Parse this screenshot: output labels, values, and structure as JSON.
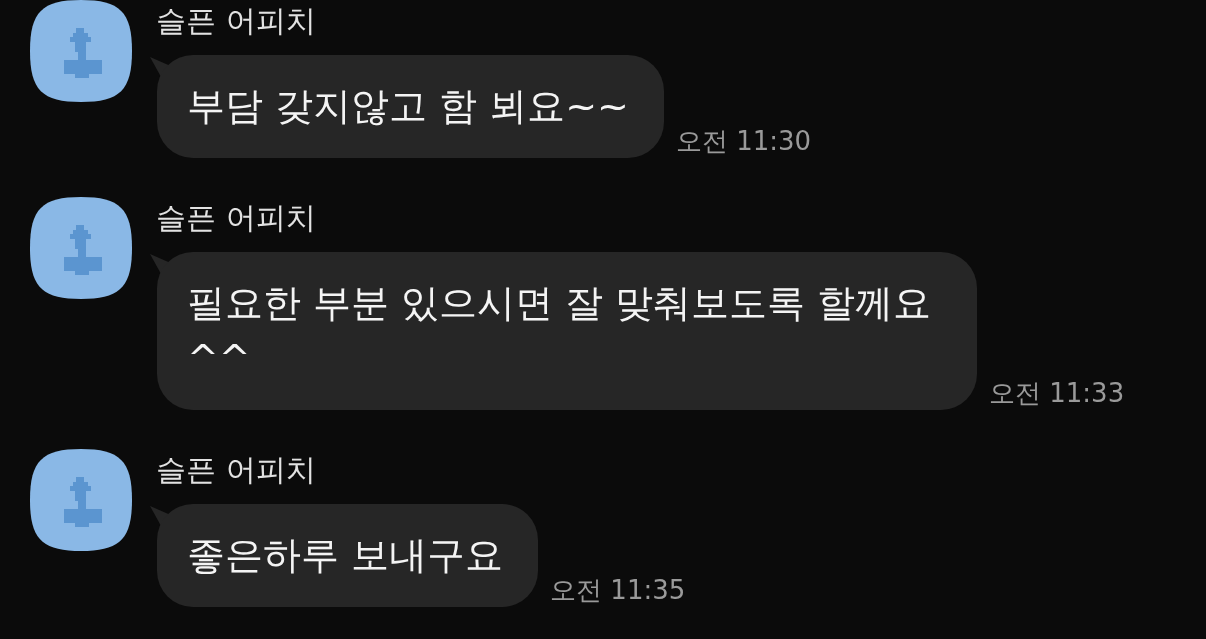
{
  "messages": [
    {
      "sender": "슬픈 어피치",
      "text": "부담 갖지않고 함 뵈요~~",
      "time": "오전 11:30"
    },
    {
      "sender": "슬픈 어피치",
      "text": "필요한 부분 있으시면 잘 맞춰보도록 할께요 ^^",
      "time": "오전 11:33"
    },
    {
      "sender": "슬픈 어피치",
      "text": "좋은하루 보내구요",
      "time": "오전 11:35"
    }
  ]
}
